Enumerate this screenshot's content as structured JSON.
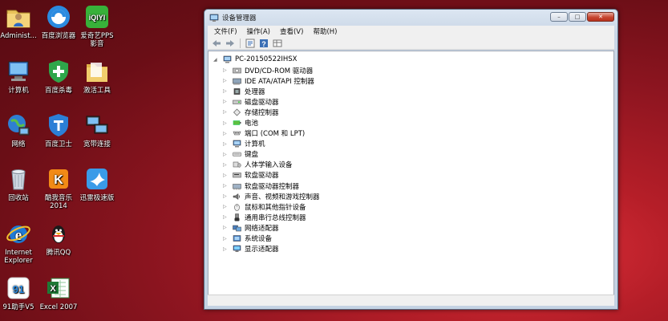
{
  "desktop": {
    "icons": [
      {
        "label": "Administ..."
      },
      {
        "label": "百度浏览器"
      },
      {
        "label": "爱奇艺PPS\n影音"
      },
      {
        "label": "计算机"
      },
      {
        "label": "百度杀毒"
      },
      {
        "label": "激活工具"
      },
      {
        "label": "网络"
      },
      {
        "label": "百度卫士"
      },
      {
        "label": "宽带连接"
      },
      {
        "label": "回收站"
      },
      {
        "label": "酷我音乐\n2014"
      },
      {
        "label": "迅雷极速版"
      },
      {
        "label": "Internet\nExplorer"
      },
      {
        "label": "腾讯QQ"
      },
      {
        "label": "91助手V5"
      },
      {
        "label": "Excel 2007"
      }
    ]
  },
  "window": {
    "title": "设备管理器",
    "buttons": {
      "minimize": "–",
      "maximize": "□",
      "close": "✕"
    },
    "menu": [
      "文件(F)",
      "操作(A)",
      "查看(V)",
      "帮助(H)"
    ],
    "tree": {
      "root": "PC-20150522IHSX",
      "items": [
        {
          "label": "DVD/CD-ROM 驱动器",
          "icon": "dvd-drive-icon"
        },
        {
          "label": "IDE ATA/ATAPI 控制器",
          "icon": "ide-controller-icon"
        },
        {
          "label": "处理器",
          "icon": "processor-icon"
        },
        {
          "label": "磁盘驱动器",
          "icon": "disk-drive-icon"
        },
        {
          "label": "存储控制器",
          "icon": "storage-controller-icon"
        },
        {
          "label": "电池",
          "icon": "battery-icon"
        },
        {
          "label": "端口 (COM 和 LPT)",
          "icon": "port-icon"
        },
        {
          "label": "计算机",
          "icon": "computer-icon"
        },
        {
          "label": "键盘",
          "icon": "keyboard-icon"
        },
        {
          "label": "人体学输入设备",
          "icon": "hid-icon"
        },
        {
          "label": "软盘驱动器",
          "icon": "floppy-drive-icon"
        },
        {
          "label": "软盘驱动器控制器",
          "icon": "floppy-controller-icon"
        },
        {
          "label": "声音、视频和游戏控制器",
          "icon": "sound-icon"
        },
        {
          "label": "鼠标和其他指针设备",
          "icon": "mouse-icon"
        },
        {
          "label": "通用串行总线控制器",
          "icon": "usb-icon"
        },
        {
          "label": "网络适配器",
          "icon": "network-adapter-icon"
        },
        {
          "label": "系统设备",
          "icon": "system-device-icon"
        },
        {
          "label": "显示适配器",
          "icon": "display-adapter-icon"
        }
      ]
    }
  }
}
